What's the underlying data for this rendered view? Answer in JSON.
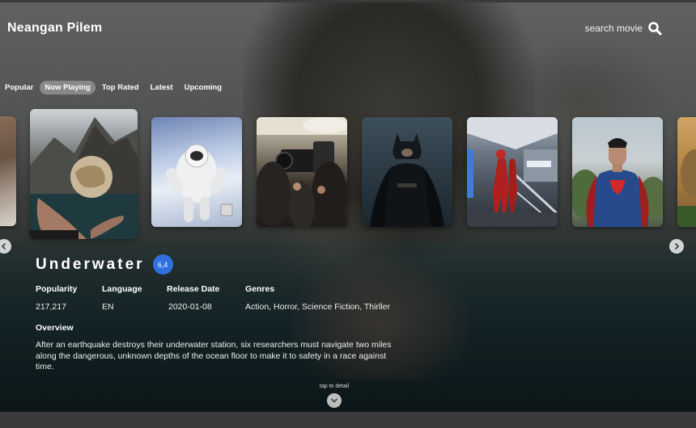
{
  "app": {
    "brand": "Neangan Pilem"
  },
  "search": {
    "label": "search movie",
    "icon": "search-icon"
  },
  "tabs": [
    {
      "label": "Popular",
      "active": false
    },
    {
      "label": "Now Playing",
      "active": true
    },
    {
      "label": "Top Rated",
      "active": false
    },
    {
      "label": "Latest",
      "active": false
    },
    {
      "label": "Upcoming",
      "active": false
    }
  ],
  "carousel": {
    "posters": [
      {
        "name": "poster-partial-left",
        "depicts": "rocky-cliff"
      },
      {
        "name": "poster-underwater",
        "depicts": "hand-globe-mountain",
        "selected": true
      },
      {
        "name": "poster-astronaut",
        "depicts": "astronaut"
      },
      {
        "name": "poster-film-crew",
        "depicts": "camera-crew"
      },
      {
        "name": "poster-batman",
        "depicts": "batman"
      },
      {
        "name": "poster-spiderman",
        "depicts": "spiderman-station"
      },
      {
        "name": "poster-superman",
        "depicts": "superman"
      },
      {
        "name": "poster-partial-right",
        "depicts": "dinosaur"
      }
    ],
    "prev_icon": "chevron-left-icon",
    "next_icon": "chevron-right-icon"
  },
  "movie": {
    "title": "Underwater",
    "rating": "6,4",
    "popularity_label": "Popularity",
    "popularity": "217,217",
    "language_label": "Language",
    "language": "EN",
    "release_label": "Release Date",
    "release_date": "2020-01-08",
    "genres_label": "Genres",
    "genres": "Action, Horror, Science Fiction, Thirller",
    "overview_label": "Overview",
    "overview": "After an earthquake destroys their underwater station, six researchers must navigate two miles along the dangerous, unknown depths of the ocean floor to make it to safety in a race against time."
  },
  "detail": {
    "tap_label": "tap to detail",
    "icon": "chevron-down-icon"
  },
  "colors": {
    "accent": "#2f6fe0",
    "tab_active_bg": "#b9b9b9"
  }
}
